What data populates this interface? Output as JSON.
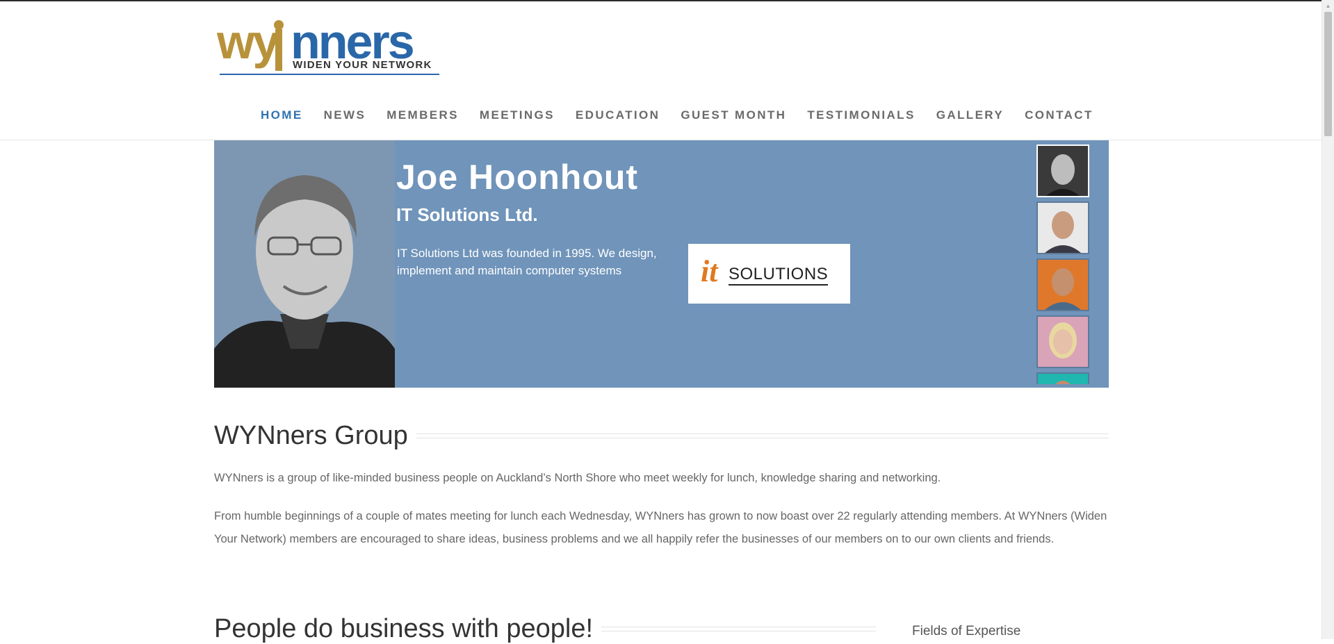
{
  "logo": {
    "wordmark": "WYNNERS",
    "tagline": "WIDEN YOUR NETWORK",
    "colors": {
      "gold": "#b8923a",
      "blue": "#2a67a8"
    }
  },
  "nav": {
    "items": [
      {
        "label": "HOME",
        "active": true
      },
      {
        "label": "NEWS",
        "active": false
      },
      {
        "label": "MEMBERS",
        "active": false
      },
      {
        "label": "MEETINGS",
        "active": false
      },
      {
        "label": "EDUCATION",
        "active": false
      },
      {
        "label": "GUEST MONTH",
        "active": false
      },
      {
        "label": "TESTIMONIALS",
        "active": false
      },
      {
        "label": "GALLERY",
        "active": false
      },
      {
        "label": "CONTACT",
        "active": false
      }
    ],
    "active_color": "#2f73b0"
  },
  "hero": {
    "name": "Joe Hoonhout",
    "company": "IT Solutions Ltd.",
    "description": "IT Solutions Ltd was founded in 1995.  We design, implement and maintain computer systems",
    "company_logo": {
      "it": "it",
      "solutions": "SOLUTIONS"
    },
    "background": "#7094ba",
    "thumbnails": [
      {
        "name": "member-thumb-1",
        "bg": "#3a3a3a",
        "selected": true
      },
      {
        "name": "member-thumb-2",
        "bg": "#e9e9e9",
        "selected": false
      },
      {
        "name": "member-thumb-3",
        "bg": "#e0782b",
        "selected": false
      },
      {
        "name": "member-thumb-4",
        "bg": "#d9a3b8",
        "selected": false
      },
      {
        "name": "member-thumb-5",
        "bg": "#1fb7b0",
        "selected": false
      }
    ]
  },
  "main": {
    "group_heading": "WYNners Group",
    "intro": "WYNners is a group of like-minded business people on Auckland’s North Shore who meet weekly for lunch, knowledge sharing and networking.",
    "history": "From humble beginnings of a couple of mates meeting for lunch each Wednesday, WYNners has grown to now boast over 22 regularly attending members. At WYNners (Widen Your Network) members are encouraged to share ideas, business problems and we all happily refer the businesses of our members on to our own clients and friends.",
    "people_heading": "People do business with people!"
  },
  "sidebar": {
    "title": "Fields of Expertise"
  }
}
